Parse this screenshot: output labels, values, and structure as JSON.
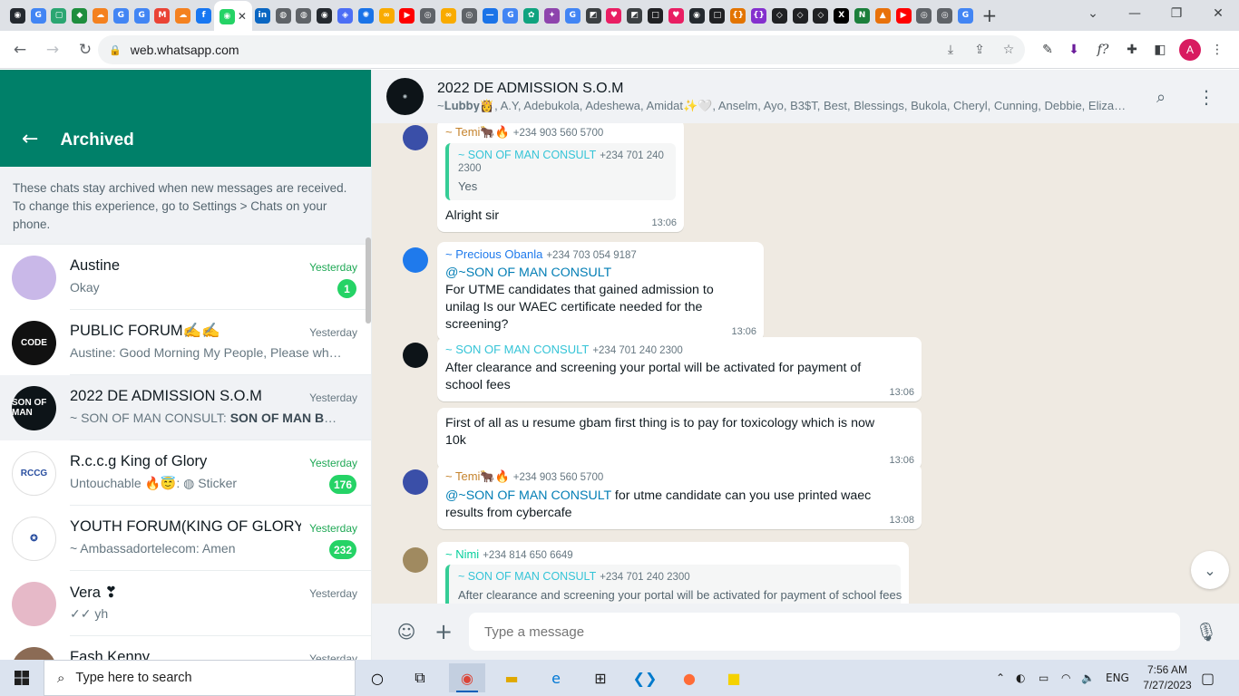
{
  "browser": {
    "tabs": [
      {
        "icon": "github-icon",
        "glyph": "◉",
        "color": "#24292f"
      },
      {
        "icon": "google-icon",
        "glyph": "G",
        "color": "#4285f4"
      },
      {
        "icon": "sheets-icon",
        "glyph": "▢",
        "color": "#2ba672"
      },
      {
        "icon": "drive-icon",
        "glyph": "◆",
        "color": "#1e8e3e"
      },
      {
        "icon": "cloud-icon",
        "glyph": "☁",
        "color": "#f48120"
      },
      {
        "icon": "google-icon",
        "glyph": "G",
        "color": "#4285f4"
      },
      {
        "icon": "google-icon",
        "glyph": "G",
        "color": "#4285f4"
      },
      {
        "icon": "gmail-icon",
        "glyph": "M",
        "color": "#ea4335"
      },
      {
        "icon": "cloud-icon",
        "glyph": "☁",
        "color": "#f48120"
      },
      {
        "icon": "facebook-icon",
        "glyph": "f",
        "color": "#1877f2"
      }
    ],
    "tabs_after": [
      {
        "icon": "linkedin-icon",
        "glyph": "in",
        "color": "#0a66c2"
      },
      {
        "icon": "globe-icon",
        "glyph": "◍",
        "color": "#5f6368"
      },
      {
        "icon": "globe-icon",
        "glyph": "◍",
        "color": "#5f6368"
      },
      {
        "icon": "github-icon",
        "glyph": "◉",
        "color": "#24292f"
      },
      {
        "icon": "bot-icon",
        "glyph": "◈",
        "color": "#4c6ef5"
      },
      {
        "icon": "gear-icon",
        "glyph": "✺",
        "color": "#1a73e8"
      },
      {
        "icon": "colab-icon",
        "glyph": "∞",
        "color": "#f9ab00"
      },
      {
        "icon": "youtube-icon",
        "glyph": "▶",
        "color": "#ff0000"
      },
      {
        "icon": "chrome-icon",
        "glyph": "◎",
        "color": "#5f6368"
      },
      {
        "icon": "colab-icon",
        "glyph": "∞",
        "color": "#f9ab00"
      },
      {
        "icon": "chrome-icon",
        "glyph": "◎",
        "color": "#5f6368"
      },
      {
        "icon": "dash-icon",
        "glyph": "—",
        "color": "#1a73e8"
      },
      {
        "icon": "google-icon",
        "glyph": "G",
        "color": "#4285f4"
      },
      {
        "icon": "chatgpt-icon",
        "glyph": "✿",
        "color": "#10a37f"
      },
      {
        "icon": "sparkle-icon",
        "glyph": "✦",
        "color": "#8e44ad"
      },
      {
        "icon": "google-icon",
        "glyph": "G",
        "color": "#4285f4"
      },
      {
        "icon": "edu-icon",
        "glyph": "◩",
        "color": "#3c4043"
      },
      {
        "icon": "heart-icon",
        "glyph": "♥",
        "color": "#e91e63"
      },
      {
        "icon": "edu-icon",
        "glyph": "◩",
        "color": "#3c4043"
      },
      {
        "icon": "square-icon",
        "glyph": "□",
        "color": "#202124"
      },
      {
        "icon": "heart-icon",
        "glyph": "♥",
        "color": "#e91e63"
      },
      {
        "icon": "github-icon",
        "glyph": "◉",
        "color": "#24292f"
      },
      {
        "icon": "square-icon",
        "glyph": "□",
        "color": "#202124"
      },
      {
        "icon": "bracket-icon",
        "glyph": "{}",
        "color": "#e37400"
      },
      {
        "icon": "bracket-icon",
        "glyph": "{}",
        "color": "#8430ce"
      },
      {
        "icon": "codepen-icon",
        "glyph": "◇",
        "color": "#202124"
      },
      {
        "icon": "codepen-icon",
        "glyph": "◇",
        "color": "#202124"
      },
      {
        "icon": "codepen-icon",
        "glyph": "◇",
        "color": "#202124"
      },
      {
        "icon": "x-icon",
        "glyph": "X",
        "color": "#000000"
      },
      {
        "icon": "n-icon",
        "glyph": "N",
        "color": "#1b7f3b"
      },
      {
        "icon": "warning-icon",
        "glyph": "▲",
        "color": "#e8710a"
      },
      {
        "icon": "youtube-icon",
        "glyph": "▶",
        "color": "#ff0000"
      },
      {
        "icon": "chrome-icon",
        "glyph": "◎",
        "color": "#5f6368"
      },
      {
        "icon": "chrome-icon",
        "glyph": "◎",
        "color": "#5f6368"
      },
      {
        "icon": "google-icon",
        "glyph": "G",
        "color": "#4285f4"
      }
    ],
    "active_tab_close": "✕",
    "new_tab": "+",
    "url": "web.whatsapp.com",
    "profile_initial": "A",
    "profile_color": "#d81b60"
  },
  "sidebar": {
    "title": "Archived",
    "info": "These chats stay archived when new messages are received. To change this experience, go to Settings > Chats on your phone.",
    "chats": [
      {
        "name": "Austine",
        "preview": "Okay",
        "time": "Yesterday",
        "unread": "1",
        "avatar_color": "#c9b8e8",
        "avatar_text": "",
        "avatar_icon": "memoji-icon"
      },
      {
        "name": "PUBLIC FORUM✍✍",
        "preview": "Austine: Good Morning My People, Please whe…",
        "time": "Yesterday",
        "unread": "",
        "avatar_color": "#111111",
        "avatar_text": "CODE",
        "avatar_icon": "code-logo-icon"
      },
      {
        "name": "2022 DE ADMISSION S.O.M",
        "preview_prefix": "~ SON OF MAN CONSULT: ",
        "preview": "SON OF MAN BUSI…",
        "time": "Yesterday",
        "unread": "",
        "avatar_color": "#0d1418",
        "avatar_text": "SON OF MAN",
        "avatar_icon": "group-logo-icon",
        "selected": true
      },
      {
        "name": "R.c.c.g King of Glory",
        "preview": "Untouchable 🔥😇: ◍ Sticker",
        "time": "Yesterday",
        "unread": "176",
        "avatar_color": "#ffffff",
        "avatar_text": "RCCG",
        "avatar_icon": "rccg-logo-icon"
      },
      {
        "name": "YOUTH FORUM(KING OF GLORY",
        "preview": "~ Ambassadortelecom: Amen",
        "time": "Yesterday",
        "unread": "232",
        "avatar_color": "#ffffff",
        "avatar_text": "✪",
        "avatar_icon": "badge-logo-icon"
      },
      {
        "name": "Vera ❣",
        "preview": "✓✓ yh",
        "time": "Yesterday",
        "unread": "",
        "avatar_color": "#e6b9c8",
        "avatar_text": "",
        "avatar_icon": "person-photo-icon"
      },
      {
        "name": "Fash Kenny",
        "preview": "",
        "time": "Yesterday",
        "unread": "",
        "avatar_color": "#8b6b55",
        "avatar_text": "",
        "avatar_icon": "person-photo-icon"
      }
    ]
  },
  "conversation": {
    "title": "2022 DE ADMISSION S.O.M",
    "members": "~𝐋𝐮𝐛𝐛𝐲👸, A.Y, Adebukola, Adeshewa, Amidat✨🤍, Anselm, Ayo, B3$T, Best, Blessings, Bukola, Cheryl, Cunning, Debbie, Elizab…",
    "messages": [
      {
        "sender": "~ Temi🐂🔥",
        "sender_color": "#c5832d",
        "phone": "+234 903 560 5700",
        "quote_name": "~ SON OF MAN CONSULT",
        "quote_phone": "+234 701 240 2300",
        "quote_text": "Yes",
        "text": "Alright sir",
        "time": "13:06",
        "avatar_color": "#3a4fa8"
      },
      {
        "sender": "~ Precious Obanla",
        "sender_color": "#1f7aec",
        "phone": "+234 703 054 9187",
        "mention": "@~SON OF MAN CONSULT",
        "text": "For UTME candidates that gained admission to unilag Is our WAEC certificate needed for the screening?",
        "time": "13:06",
        "avatar_color": "#1f7aec"
      },
      {
        "sender": "~ SON OF MAN CONSULT",
        "sender_color": "#35c4d7",
        "phone": "+234 701 240 2300",
        "text": "After clearance and screening your portal will be activated for payment of school fees",
        "time": "13:06",
        "avatar_color": "#0d1418"
      },
      {
        "text": "First of all as u resume gbam first thing is to pay for toxicology which is now 10k",
        "time": "13:06"
      },
      {
        "sender": "~ Temi🐂🔥",
        "sender_color": "#c5832d",
        "phone": "+234 903 560 5700",
        "mention": "@~SON OF MAN CONSULT",
        "text": "for utme candidate can you use printed waec results from cybercafe",
        "time": "13:08",
        "avatar_color": "#3a4fa8"
      },
      {
        "sender": "~ Nimi",
        "sender_color": "#06cf9c",
        "phone": "+234 814 650 6649",
        "quote_name": "~ SON OF MAN CONSULT",
        "quote_phone": "+234 701 240 2300",
        "quote_text": "After clearance and screening your portal will be activated for payment of school fees",
        "avatar_color": "#a08a60"
      }
    ],
    "composer_placeholder": "Type a message"
  },
  "taskbar": {
    "search_placeholder": "Type here to search",
    "lang": "ENG",
    "time": "7:56 AM",
    "date": "7/27/2023"
  }
}
